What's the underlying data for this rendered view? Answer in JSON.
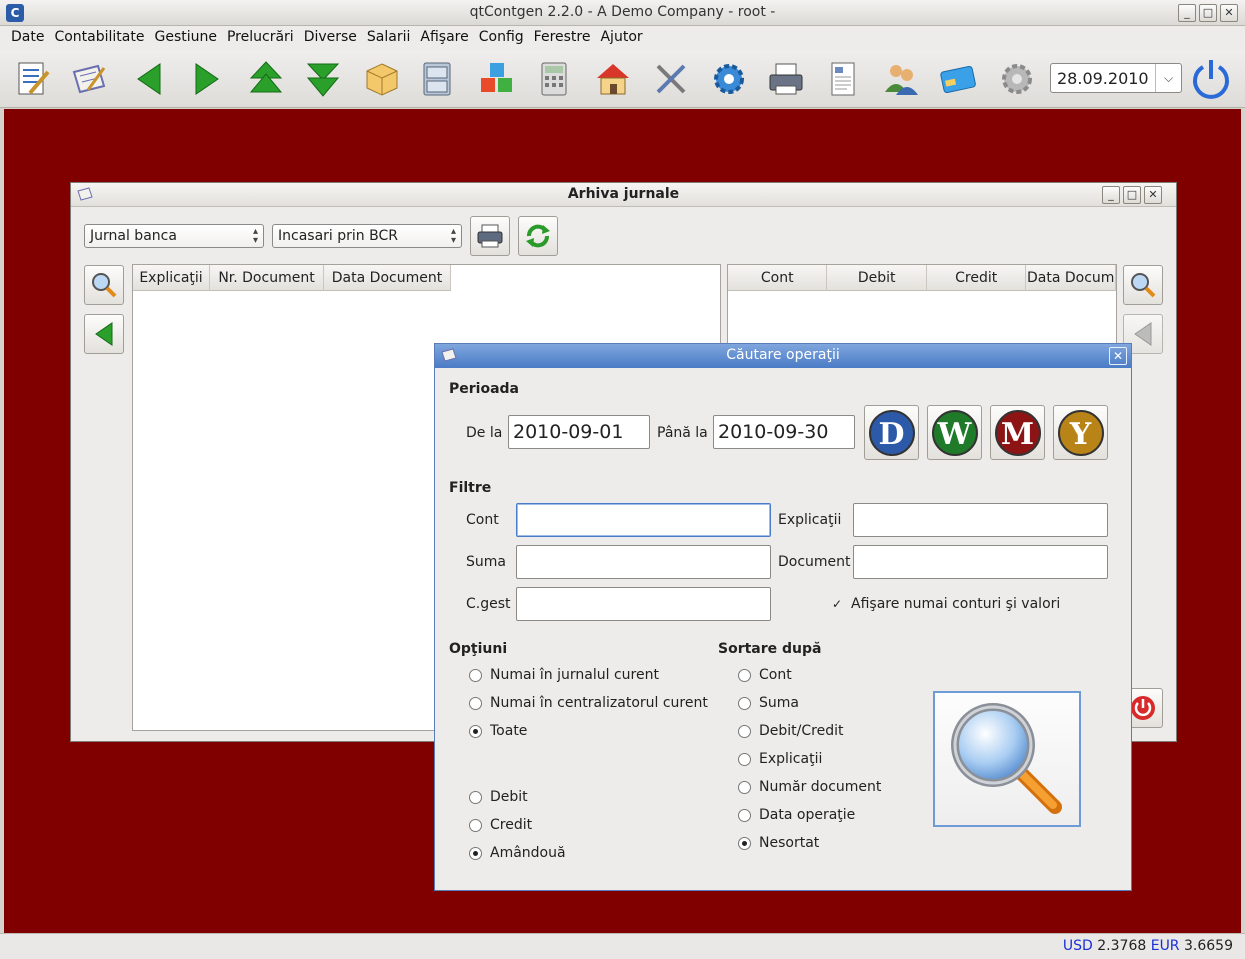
{
  "window": {
    "title": "qtContgen 2.2.0 - A Demo Company - root -"
  },
  "menu": [
    "Date",
    "Contabilitate",
    "Gestiune",
    "Prelucrări",
    "Diverse",
    "Salarii",
    "Afişare",
    "Config",
    "Ferestre",
    "Ajutor"
  ],
  "toolbar": {
    "icons": [
      "journal-edit-icon",
      "notes-icon",
      "arrow-left-icon",
      "arrow-right-icon",
      "arrow-up-icon",
      "arrow-down-icon",
      "box-icon",
      "cabinet-icon",
      "cubes-icon",
      "calculator-icon",
      "home-icon",
      "tools-icon",
      "gears-icon",
      "printer-icon",
      "document-icon",
      "users-icon",
      "card-icon",
      "settings-icon",
      "power-icon"
    ],
    "date": "28.09.2010"
  },
  "status": {
    "usd_label": "USD",
    "usd_value": "2.3768",
    "eur_label": "EUR",
    "eur_value": "3.6659"
  },
  "arhiva": {
    "title": "Arhiva jurnale",
    "journal_combo": "Jurnal banca",
    "sub_combo": "Incasari prin BCR",
    "left_columns": [
      "Explicaţii",
      "Nr. Document",
      "Data Document"
    ],
    "right_columns": [
      "Cont",
      "Debit",
      "Credit",
      "Data Docum"
    ]
  },
  "dialog": {
    "title": "Căutare operaţii",
    "perioada": "Perioada",
    "de_la_label": "De la",
    "de_la_value": "2010-09-01",
    "pana_la_label": "Până la",
    "pana_la_value": "2010-09-30",
    "period_buttons": [
      {
        "letter": "D",
        "color": "#2d5aa8"
      },
      {
        "letter": "W",
        "color": "#1f7a2a"
      },
      {
        "letter": "M",
        "color": "#8c1414"
      },
      {
        "letter": "Y",
        "color": "#b88418"
      }
    ],
    "filtre": "Filtre",
    "cont_label": "Cont",
    "cont_value": "",
    "explicatii_label": "Explicaţii",
    "explicatii_value": "",
    "suma_label": "Suma",
    "suma_value": "",
    "document_label": "Document",
    "document_value": "",
    "cgest_label": "C.gest",
    "cgest_value": "",
    "check_label": "Afişare numai conturi şi valori",
    "check_checked": true,
    "optiuni": "Opţiuni",
    "options": [
      {
        "label": "Numai în jurnalul curent",
        "checked": false
      },
      {
        "label": "Numai în centralizatorul curent",
        "checked": false
      },
      {
        "label": "Toate",
        "checked": true
      }
    ],
    "dc_options": [
      {
        "label": "Debit",
        "checked": false
      },
      {
        "label": "Credit",
        "checked": false
      },
      {
        "label": "Amândouă",
        "checked": true
      }
    ],
    "sortare": "Sortare după",
    "sort_options": [
      {
        "label": "Cont",
        "checked": false
      },
      {
        "label": "Suma",
        "checked": false
      },
      {
        "label": "Debit/Credit",
        "checked": false
      },
      {
        "label": "Explicaţii",
        "checked": false
      },
      {
        "label": "Număr document",
        "checked": false
      },
      {
        "label": "Data operaţie",
        "checked": false
      },
      {
        "label": "Nesortat",
        "checked": true
      }
    ]
  }
}
